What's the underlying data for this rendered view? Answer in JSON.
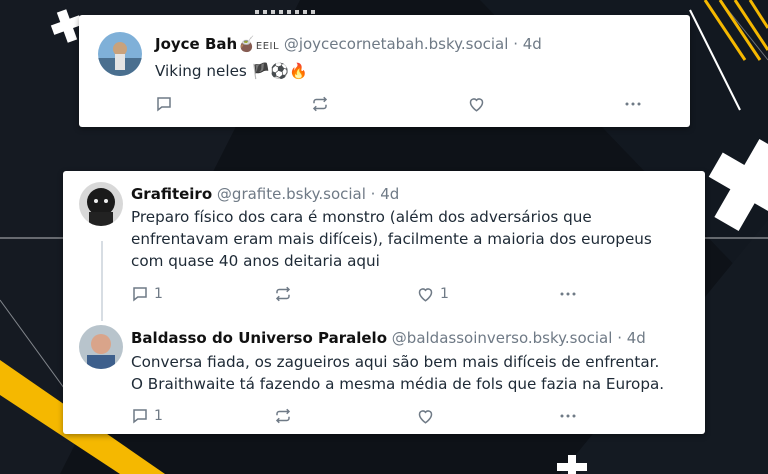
{
  "post1": {
    "author": "Joyce Bah",
    "badge": "EEIL",
    "handle": "@joycecornetabah.bsky.social",
    "age": "· 4d",
    "text": "Viking neles",
    "emojis": "🏴⚽🔥"
  },
  "post2": {
    "author": "Grafiteiro",
    "handle": "@grafite.bsky.social",
    "age": "· 4d",
    "lines": [
      "Preparo físico dos cara é monstro (além dos adversários que",
      "enfrentavam eram mais difíceis),  facilmente a maioria dos europeus",
      "com quase 40 anos deitaria aqui"
    ],
    "reply_count": "1",
    "like_count": "1"
  },
  "post3": {
    "author": "Baldasso do Universo Paralelo",
    "handle": "@baldassoinverso.bsky.social",
    "age": "· 4d",
    "lines": [
      "Conversa fiada, os zagueiros aqui são bem mais difíceis de enfrentar.",
      "O Braithwaite tá fazendo a mesma média de fols que fazia na Europa."
    ],
    "reply_count": "1"
  },
  "colors": {
    "background": "#0d1117",
    "accent_yellow": "#f5b800",
    "text_muted": "#6f7a86",
    "card": "#ffffff"
  },
  "icons": [
    "reply-icon",
    "repost-icon",
    "like-icon",
    "more-icon"
  ]
}
